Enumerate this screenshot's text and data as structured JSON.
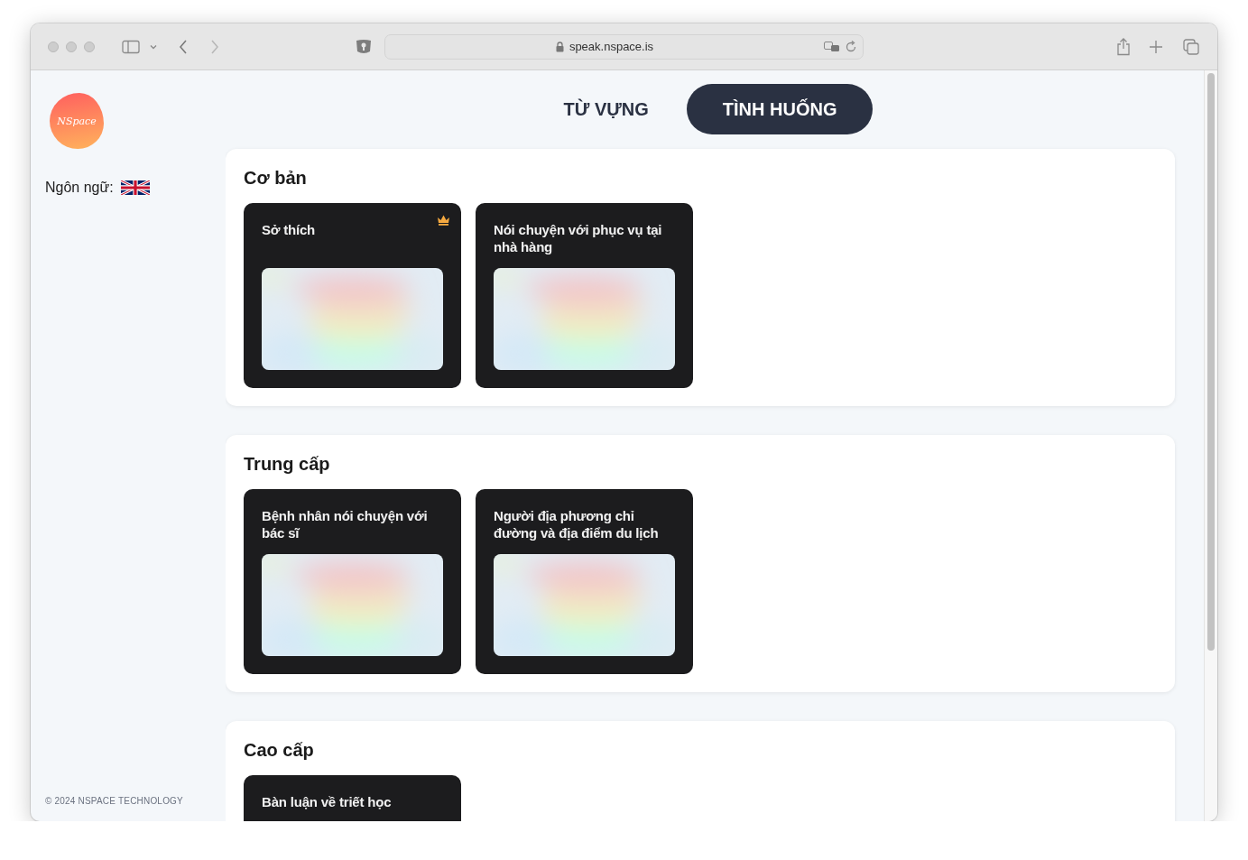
{
  "browser": {
    "url": "speak.nspace.is"
  },
  "sidebar": {
    "logo": "NSpace",
    "language_label": "Ngôn ngữ:",
    "footer": "© 2024 NSPACE TECHNOLOGY"
  },
  "tabs": [
    {
      "label": "TỪ VỰNG",
      "selected": false
    },
    {
      "label": "TÌNH HUỐNG",
      "selected": true
    }
  ],
  "sections": [
    {
      "title": "Cơ bản",
      "cards": [
        {
          "title": "Sở thích",
          "premium": true
        },
        {
          "title": "Nói chuyện với phục vụ tại nhà hàng",
          "premium": false
        }
      ]
    },
    {
      "title": "Trung cấp",
      "cards": [
        {
          "title": "Bệnh nhân nói chuyện với bác sĩ",
          "premium": false
        },
        {
          "title": "Người địa phương chỉ đường và địa điểm du lịch",
          "premium": false
        }
      ]
    },
    {
      "title": "Cao cấp",
      "cards": [
        {
          "title": "Bàn luận về triết học",
          "premium": false
        }
      ]
    }
  ]
}
